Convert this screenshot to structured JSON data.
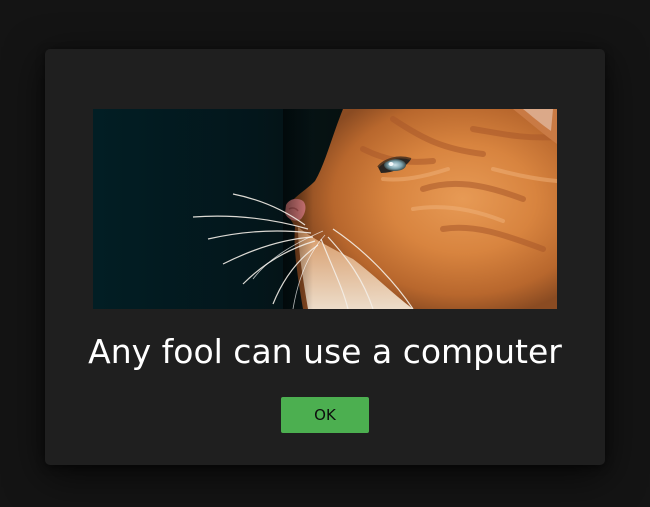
{
  "dialog": {
    "image": {
      "subject": "kitten-photo"
    },
    "message": "Any fool can use a computer",
    "ok_label": "OK"
  },
  "colors": {
    "page_background": "#141414",
    "dialog_background": "#1f1f1f",
    "text": "#ffffff",
    "ok_button": "#4caf50",
    "ok_button_text": "#0d0d0d"
  }
}
